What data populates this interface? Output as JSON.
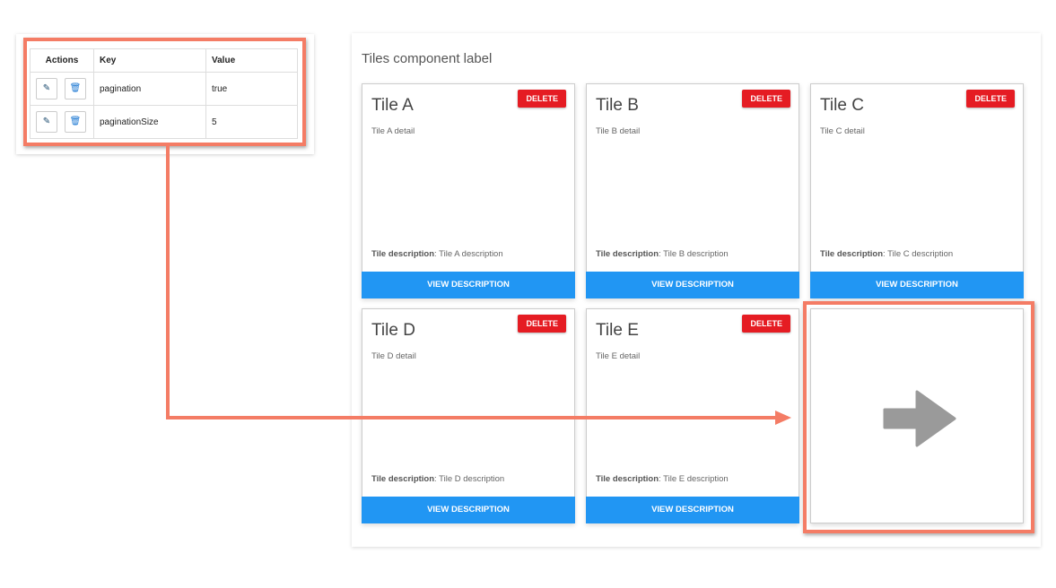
{
  "config_table": {
    "headers": {
      "actions": "Actions",
      "key": "Key",
      "value": "Value"
    },
    "rows": [
      {
        "key": "pagination",
        "value": "true"
      },
      {
        "key": "paginationSize",
        "value": "5"
      }
    ]
  },
  "tiles_panel": {
    "label": "Tiles component label",
    "delete_label": "DELETE",
    "view_label": "VIEW DESCRIPTION",
    "desc_prefix": "Tile description",
    "tiles": [
      {
        "title": "Tile A",
        "detail": "Tile A detail",
        "description": "Tile A description"
      },
      {
        "title": "Tile B",
        "detail": "Tile B detail",
        "description": "Tile B description"
      },
      {
        "title": "Tile C",
        "detail": "Tile C detail",
        "description": "Tile C description"
      },
      {
        "title": "Tile D",
        "detail": "Tile D detail",
        "description": "Tile D description"
      },
      {
        "title": "Tile E",
        "detail": "Tile E detail",
        "description": "Tile E description"
      }
    ],
    "next_page_icon": "arrow-right-icon"
  },
  "colors": {
    "highlight": "#f47c65",
    "delete": "#e51c23",
    "primary": "#2196f3"
  }
}
